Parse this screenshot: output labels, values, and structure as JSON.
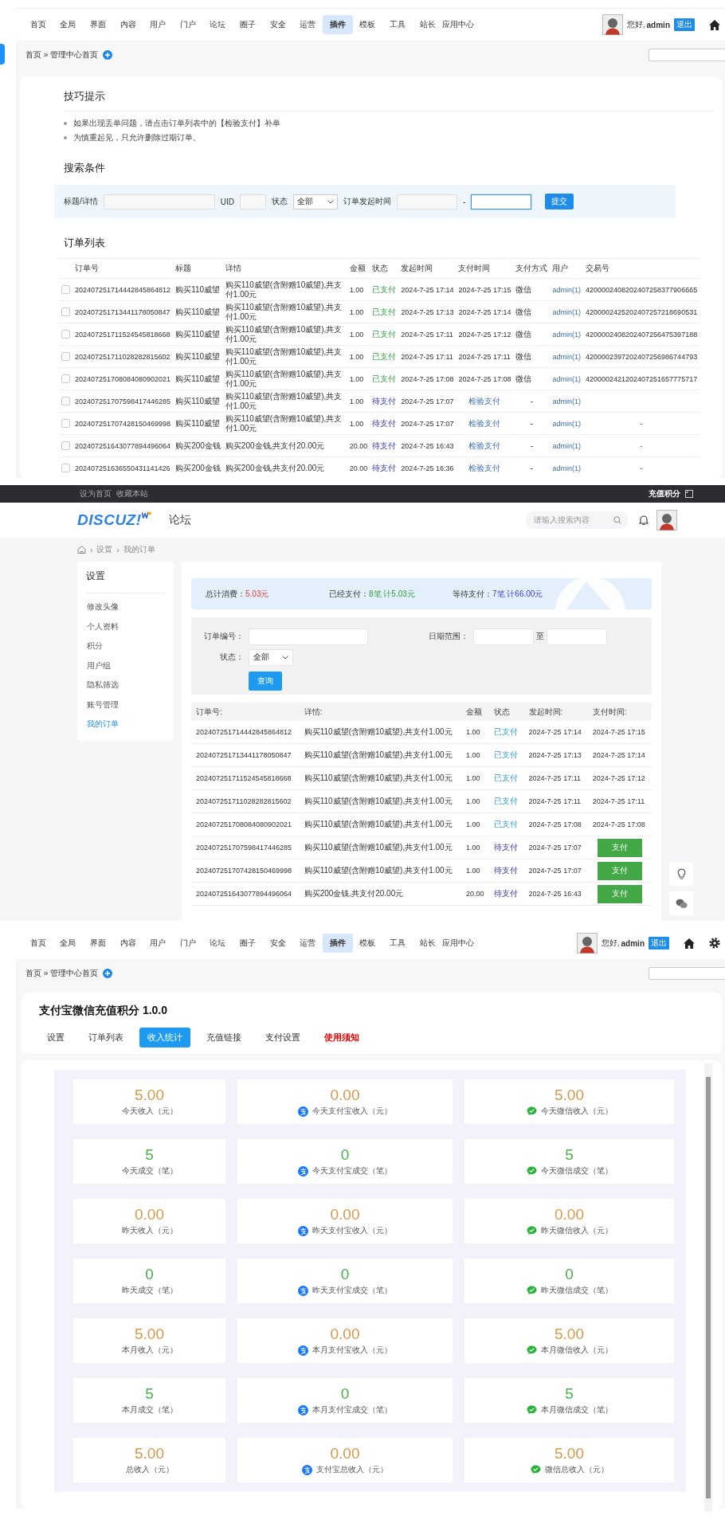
{
  "admin_orders_page": {
    "nav": {
      "items": [
        {
          "label": "首页",
          "selected": false
        },
        {
          "label": "全局",
          "selected": false
        },
        {
          "label": "界面",
          "selected": false
        },
        {
          "label": "内容",
          "selected": false
        },
        {
          "label": "用户",
          "selected": false
        },
        {
          "label": "门户",
          "selected": false
        },
        {
          "label": "论坛",
          "selected": false
        },
        {
          "label": "圈子",
          "selected": false
        },
        {
          "label": "安全",
          "selected": false
        },
        {
          "label": "运营",
          "selected": false
        },
        {
          "label": "插件",
          "selected": true
        },
        {
          "label": "模板",
          "selected": false
        },
        {
          "label": "工具",
          "selected": false
        },
        {
          "label": "站长",
          "selected": false
        },
        {
          "label": "应用中心",
          "selected": false
        }
      ],
      "greeting": "您好,",
      "user": "admin",
      "logout": "退出"
    },
    "breadcrumb": "首页 » 管理中心首页",
    "tips": {
      "title": "技巧提示",
      "items": [
        "如果出现丢单问题，请点击订单列表中的【检验支付】补单",
        "为慎重起见，只允许删除过期订单。"
      ]
    },
    "search": {
      "title": "搜索条件",
      "keyword_label": "标题/详情",
      "uid_label": "UID",
      "status_label": "状态",
      "status_value": "全部",
      "time_label": "订单发起时间",
      "range_separator": "-",
      "end_focused": true,
      "submit": "提交"
    },
    "orders": {
      "title": "订单列表",
      "columns": [
        "订单号",
        "标题",
        "详情",
        "金额",
        "状态",
        "发起时间",
        "支付时间",
        "支付方式",
        "用户",
        "交易号"
      ],
      "rows": [
        {
          "checked": false,
          "order_no": "202407251714442845864812",
          "title": "购买110威望",
          "detail": "购买110威望(含附赠10威望),共支付1.00元",
          "amount": "1.00",
          "status": "已支付",
          "paid": true,
          "start_time": "2024-7-25 17:14",
          "pay_time": "2024-7-25 17:15",
          "method": "微信",
          "user": "admin(1)",
          "trade_no": "4200002408202407258377906665"
        },
        {
          "checked": false,
          "order_no": "202407251713441178050847",
          "title": "购买110威望",
          "detail": "购买110威望(含附赠10威望),共支付1.00元",
          "amount": "1.00",
          "status": "已支付",
          "paid": true,
          "start_time": "2024-7-25 17:13",
          "pay_time": "2024-7-25 17:14",
          "method": "微信",
          "user": "admin(1)",
          "trade_no": "4200002425202407257218690531"
        },
        {
          "checked": false,
          "order_no": "202407251711524545818668",
          "title": "购买110威望",
          "detail": "购买110威望(含附赠10威望),共支付1.00元",
          "amount": "1.00",
          "status": "已支付",
          "paid": true,
          "start_time": "2024-7-25 17:11",
          "pay_time": "2024-7-25 17:12",
          "method": "微信",
          "user": "admin(1)",
          "trade_no": "4200002408202407256475397188"
        },
        {
          "checked": false,
          "order_no": "202407251711028282815602",
          "title": "购买110威望",
          "detail": "购买110威望(含附赠10威望),共支付1.00元",
          "amount": "1.00",
          "status": "已支付",
          "paid": true,
          "start_time": "2024-7-25 17:11",
          "pay_time": "2024-7-25 17:11",
          "method": "微信",
          "user": "admin(1)",
          "trade_no": "4200002397202407256986744793"
        },
        {
          "checked": false,
          "order_no": "202407251708084080902021",
          "title": "购买110威望",
          "detail": "购买110威望(含附赠10威望),共支付1.00元",
          "amount": "1.00",
          "status": "已支付",
          "paid": true,
          "start_time": "2024-7-25 17:08",
          "pay_time": "2024-7-25 17:08",
          "method": "微信",
          "user": "admin(1)",
          "trade_no": "4200002421202407251657775717"
        },
        {
          "checked": false,
          "order_no": "202407251707598417446285",
          "title": "购买110威望",
          "detail": "购买110威望(含附赠10威望),共支付1.00元",
          "amount": "1.00",
          "status": "待支付",
          "paid": false,
          "start_time": "2024-7-25 17:07",
          "action": "检验支付",
          "method": "-",
          "user": "admin(1)"
        },
        {
          "checked": false,
          "order_no": "202407251707428150469998",
          "title": "购买110威望",
          "detail": "购买110威望(含附赠10威望),共支付1.00元",
          "amount": "1.00",
          "status": "待支付",
          "paid": false,
          "start_time": "2024-7-25 17:07",
          "action": "检验支付",
          "method": "-",
          "user": "admin(1)",
          "trade_no": "-"
        },
        {
          "checked": false,
          "order_no": "202407251643077894496064",
          "title": "购买200金钱",
          "detail": "购买200金钱,共支付20.00元",
          "amount": "20.00",
          "status": "待支付",
          "paid": false,
          "start_time": "2024-7-25 16:43",
          "action": "检验支付",
          "method": "-",
          "user": "admin(1)",
          "trade_no": "-"
        },
        {
          "checked": false,
          "order_no": "202407251636550431141426",
          "title": "购买200金钱",
          "detail": "购买200金钱,共支付20.00元",
          "amount": "20.00",
          "status": "待支付",
          "paid": false,
          "start_time": "2024-7-25 16:36",
          "action": "检验支付",
          "method": "-",
          "user": "admin(1)",
          "trade_no": "-"
        }
      ]
    }
  },
  "front_orders_page": {
    "topbar": {
      "links": [
        "设为首页",
        "收藏本站"
      ],
      "right": "充值积分"
    },
    "header": {
      "logo": "DISCUZ!",
      "section": "论坛",
      "search_placeholder": "请输入搜索内容"
    },
    "breadcrumb": [
      {
        "separator": "›",
        "label": "设置"
      },
      {
        "separator": "›",
        "label": "我的订单"
      }
    ],
    "sidebar": {
      "title": "设置",
      "items": [
        {
          "label": "修改头像",
          "selected": false
        },
        {
          "label": "个人资料",
          "selected": false
        },
        {
          "label": "积分",
          "selected": false
        },
        {
          "label": "用户组",
          "selected": false
        },
        {
          "label": "隐私筛选",
          "selected": false
        },
        {
          "label": "账号管理",
          "selected": false
        },
        {
          "label": "我的订单",
          "selected": true
        }
      ]
    },
    "summary": [
      {
        "label": "总计消费：",
        "value": "5.03元",
        "kind": "total"
      },
      {
        "label": "已经支付：",
        "value": "8笔 计5.03元",
        "kind": "paid"
      },
      {
        "label": "等待支付：",
        "value": "7笔 计66.00元",
        "kind": "pending"
      }
    ],
    "filter": {
      "order_label": "订单编号：",
      "date_label": "日期范围：",
      "date_separator": "至",
      "status_label": "状态：",
      "status_value": "全部",
      "submit": "查询"
    },
    "table": {
      "columns": [
        "订单号:",
        "详情:",
        "金额",
        "状态",
        "发起时间:",
        "支付时间:"
      ],
      "rows": [
        {
          "order_no": "202407251714442845864812",
          "detail": "购买110威望(含附赠10威望),共支付1.00元",
          "amount": "1.00",
          "status": "已支付",
          "paid": true,
          "start_time": "2024-7-25 17:14",
          "pay_time": "2024-7-25 17:15"
        },
        {
          "order_no": "202407251713441178050847",
          "detail": "购买110威望(含附赠10威望),共支付1.00元",
          "amount": "1.00",
          "status": "已支付",
          "paid": true,
          "start_time": "2024-7-25 17:13",
          "pay_time": "2024-7-25 17:14"
        },
        {
          "order_no": "202407251711524545818668",
          "detail": "购买110威望(含附赠10威望),共支付1.00元",
          "amount": "1.00",
          "status": "已支付",
          "paid": true,
          "start_time": "2024-7-25 17:11",
          "pay_time": "2024-7-25 17:12"
        },
        {
          "order_no": "202407251711028282815602",
          "detail": "购买110威望(含附赠10威望),共支付1.00元",
          "amount": "1.00",
          "status": "已支付",
          "paid": true,
          "start_time": "2024-7-25 17:11",
          "pay_time": "2024-7-25 17:11"
        },
        {
          "order_no": "202407251708084080902021",
          "detail": "购买110威望(含附赠10威望),共支付1.00元",
          "amount": "1.00",
          "status": "已支付",
          "paid": true,
          "start_time": "2024-7-25 17:08",
          "pay_time": "2024-7-25 17:08"
        },
        {
          "order_no": "202407251707598417446285",
          "detail": "购买110威望(含附赠10威望),共支付1.00元",
          "amount": "1.00",
          "status": "待支付",
          "paid": false,
          "start_time": "2024-7-25 17:07",
          "action": "支付"
        },
        {
          "order_no": "202407251707428150469998",
          "detail": "购买110威望(含附赠10威望),共支付1.00元",
          "amount": "1.00",
          "status": "待支付",
          "paid": false,
          "start_time": "2024-7-25 17:07",
          "action": "支付"
        },
        {
          "order_no": "202407251643077894496064",
          "detail": "购买200金钱,共支付20.00元",
          "amount": "20.00",
          "status": "待支付",
          "paid": false,
          "start_time": "2024-7-25 16:43",
          "action": "支付"
        }
      ]
    }
  },
  "admin_stats_page": {
    "nav": {
      "items": [
        {
          "label": "首页",
          "selected": false
        },
        {
          "label": "全局",
          "selected": false
        },
        {
          "label": "界面",
          "selected": false
        },
        {
          "label": "内容",
          "selected": false
        },
        {
          "label": "用户",
          "selected": false
        },
        {
          "label": "门户",
          "selected": false
        },
        {
          "label": "论坛",
          "selected": false
        },
        {
          "label": "圈子",
          "selected": false
        },
        {
          "label": "安全",
          "selected": false
        },
        {
          "label": "运营",
          "selected": false
        },
        {
          "label": "插件",
          "selected": true
        },
        {
          "label": "模板",
          "selected": false
        },
        {
          "label": "工具",
          "selected": false
        },
        {
          "label": "站长",
          "selected": false
        },
        {
          "label": "应用中心",
          "selected": false
        }
      ],
      "greeting": "您好,",
      "user": "admin",
      "logout": "退出"
    },
    "breadcrumb": "首页 » 管理中心首页",
    "plugin_title": "支付宝微信充值积分 1.0.0",
    "tabs": [
      {
        "label": "设置",
        "selected": false,
        "kind": "normal"
      },
      {
        "label": "订单列表",
        "selected": false,
        "kind": "normal"
      },
      {
        "label": "收入统计",
        "selected": true,
        "kind": "normal"
      },
      {
        "label": "充值链接",
        "selected": false,
        "kind": "normal"
      },
      {
        "label": "支付设置",
        "selected": false,
        "kind": "normal"
      },
      {
        "label": "使用须知",
        "selected": false,
        "kind": "notice"
      }
    ],
    "stat_rows": [
      {
        "kind": "money",
        "cards": [
          {
            "value": "5.00",
            "label": "今天收入（元）",
            "kind": "total"
          },
          {
            "value": "0.00",
            "label": "今天支付宝收入（元）",
            "kind": "alipay"
          },
          {
            "value": "5.00",
            "label": "今天微信收入（元）",
            "kind": "wechat"
          }
        ]
      },
      {
        "kind": "count",
        "cards": [
          {
            "value": "5",
            "label": "今天成交（笔）",
            "kind": "total"
          },
          {
            "value": "0",
            "label": "今天支付宝成交（笔）",
            "kind": "alipay"
          },
          {
            "value": "5",
            "label": "今天微信成交（笔）",
            "kind": "wechat"
          }
        ]
      },
      {
        "kind": "money",
        "cards": [
          {
            "value": "0.00",
            "label": "昨天收入（元）",
            "kind": "total"
          },
          {
            "value": "0.00",
            "label": "昨天支付宝收入（元）",
            "kind": "alipay"
          },
          {
            "value": "0.00",
            "label": "昨天微信收入（元）",
            "kind": "wechat"
          }
        ]
      },
      {
        "kind": "count",
        "cards": [
          {
            "value": "0",
            "label": "昨天成交（笔）",
            "kind": "total"
          },
          {
            "value": "0",
            "label": "昨天支付宝成交（笔）",
            "kind": "alipay"
          },
          {
            "value": "0",
            "label": "昨天微信成交（笔）",
            "kind": "wechat"
          }
        ]
      },
      {
        "kind": "money",
        "cards": [
          {
            "value": "5.00",
            "label": "本月收入（元）",
            "kind": "total"
          },
          {
            "value": "0.00",
            "label": "本月支付宝收入（元）",
            "kind": "alipay"
          },
          {
            "value": "5.00",
            "label": "本月微信收入（元）",
            "kind": "wechat"
          }
        ]
      },
      {
        "kind": "count",
        "cards": [
          {
            "value": "5",
            "label": "本月成交（笔）",
            "kind": "total"
          },
          {
            "value": "0",
            "label": "本月支付宝成交（笔）",
            "kind": "alipay"
          },
          {
            "value": "5",
            "label": "本月微信成交（笔）",
            "kind": "wechat"
          }
        ]
      },
      {
        "kind": "money",
        "cards": [
          {
            "value": "5.00",
            "label": "总收入（元）",
            "kind": "total"
          },
          {
            "value": "0.00",
            "label": "支付宝总收入（元）",
            "kind": "alipay"
          },
          {
            "value": "5.00",
            "label": "微信总收入（元）",
            "kind": "wechat"
          }
        ]
      }
    ]
  }
}
